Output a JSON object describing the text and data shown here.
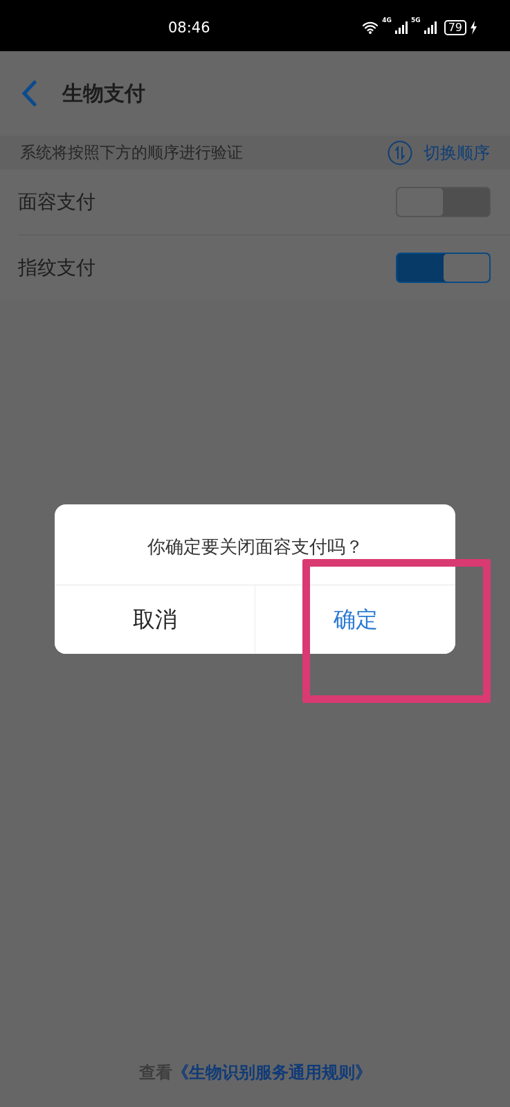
{
  "status_bar": {
    "time": "08:46",
    "network_1": "4G",
    "network_2": "5G",
    "battery": "79"
  },
  "header": {
    "title": "生物支付"
  },
  "order_hint": {
    "text": "系统将按照下方的顺序进行验证",
    "action": "切换顺序"
  },
  "options": [
    {
      "label": "面容支付",
      "on": false
    },
    {
      "label": "指纹支付",
      "on": true
    }
  ],
  "dialog": {
    "message": "你确定要关闭面容支付吗？",
    "buttons": [
      {
        "label": "取消",
        "kind": "cancel"
      },
      {
        "label": "确定",
        "kind": "confirm"
      }
    ]
  },
  "footer": {
    "prefix": "查看",
    "link": "《生物识别服务通用规则》"
  }
}
